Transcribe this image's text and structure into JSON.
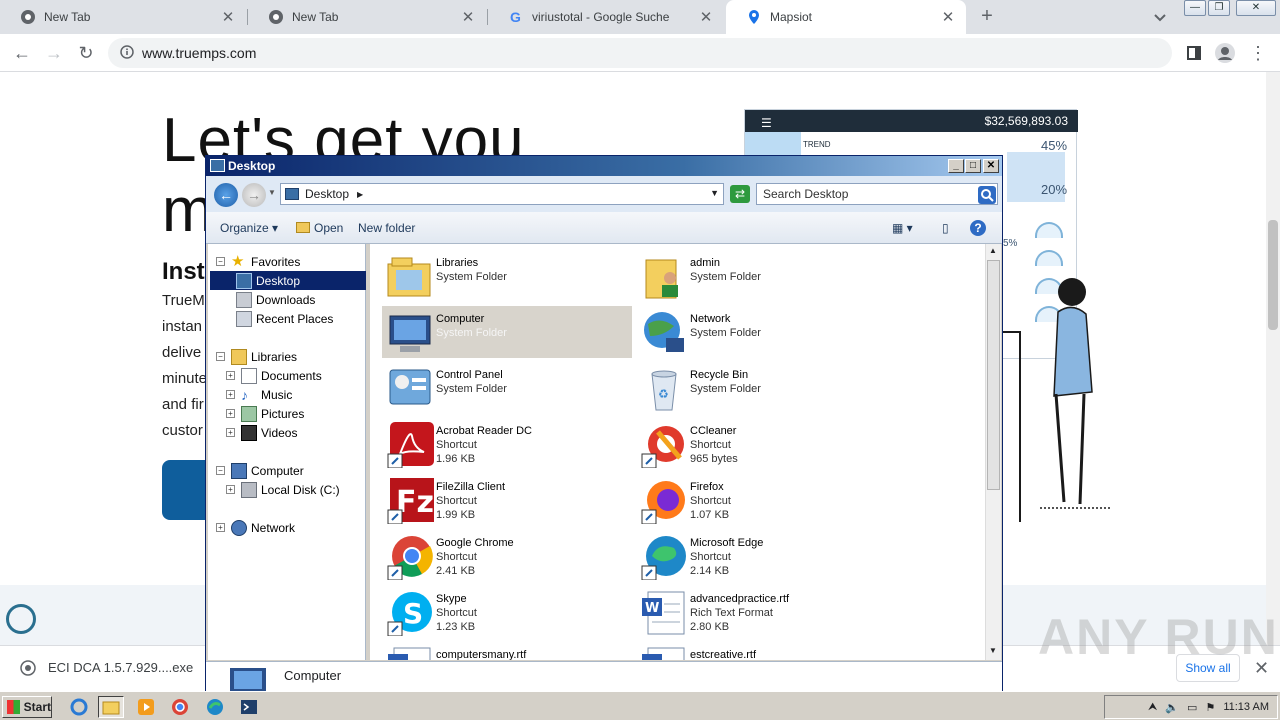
{
  "browser": {
    "tabs": [
      {
        "title": "New Tab",
        "icon": "chrome-icon"
      },
      {
        "title": "New Tab",
        "icon": "chrome-icon"
      },
      {
        "title": "viriustotal - Google Suche",
        "icon": "google-icon"
      },
      {
        "title": "Mapsiot",
        "icon": "map-pin-icon",
        "active": true
      }
    ],
    "url": "www.truemps.com"
  },
  "webpage": {
    "hero_line1": "Let's get you",
    "hero_line2": "m",
    "heading": "Inst",
    "para_lines": [
      "TrueM",
      "instan",
      "delive",
      "minute",
      "and fir",
      "custor"
    ],
    "dashboard": {
      "amount": "$32,569,893.03",
      "trend_label": "TREND",
      "pct_top": "45%",
      "pct_mid": "20%",
      "pct_side": "5%"
    }
  },
  "explorer": {
    "title": "Desktop",
    "address": "Desktop",
    "search_placeholder": "Search Desktop",
    "commands": {
      "organize": "Organize",
      "open": "Open",
      "new_folder": "New folder"
    },
    "nav": {
      "favorites": "Favorites",
      "desktop": "Desktop",
      "downloads": "Downloads",
      "recent": "Recent Places",
      "libraries": "Libraries",
      "documents": "Documents",
      "music": "Music",
      "pictures": "Pictures",
      "videos": "Videos",
      "computer": "Computer",
      "local_disk": "Local Disk (C:)",
      "network": "Network"
    },
    "items": [
      {
        "name": "Libraries",
        "line2": "System Folder",
        "line3": ""
      },
      {
        "name": "admin",
        "line2": "System Folder",
        "line3": ""
      },
      {
        "name": "Computer",
        "line2": "System Folder",
        "line3": ""
      },
      {
        "name": "Network",
        "line2": "System Folder",
        "line3": ""
      },
      {
        "name": "Control Panel",
        "line2": "System Folder",
        "line3": ""
      },
      {
        "name": "Recycle Bin",
        "line2": "System Folder",
        "line3": ""
      },
      {
        "name": "Acrobat Reader DC",
        "line2": "Shortcut",
        "line3": "1.96 KB"
      },
      {
        "name": "CCleaner",
        "line2": "Shortcut",
        "line3": "965 bytes"
      },
      {
        "name": "FileZilla Client",
        "line2": "Shortcut",
        "line3": "1.99 KB"
      },
      {
        "name": "Firefox",
        "line2": "Shortcut",
        "line3": "1.07 KB"
      },
      {
        "name": "Google Chrome",
        "line2": "Shortcut",
        "line3": "2.41 KB"
      },
      {
        "name": "Microsoft Edge",
        "line2": "Shortcut",
        "line3": "2.14 KB"
      },
      {
        "name": "Skype",
        "line2": "Shortcut",
        "line3": "1.23 KB"
      },
      {
        "name": "advancedpractice.rtf",
        "line2": "Rich Text Format",
        "line3": "2.80 KB"
      },
      {
        "name": "computersmany.rtf",
        "line2": "",
        "line3": ""
      },
      {
        "name": "estcreative.rtf",
        "line2": "",
        "line3": ""
      }
    ],
    "details_label": "Computer"
  },
  "download": {
    "filename": "ECI DCA 1.5.7.929....exe",
    "show_all": "Show all"
  },
  "watermark": "ANY RUN",
  "taskbar": {
    "start": "Start",
    "clock": "11:13 AM"
  }
}
